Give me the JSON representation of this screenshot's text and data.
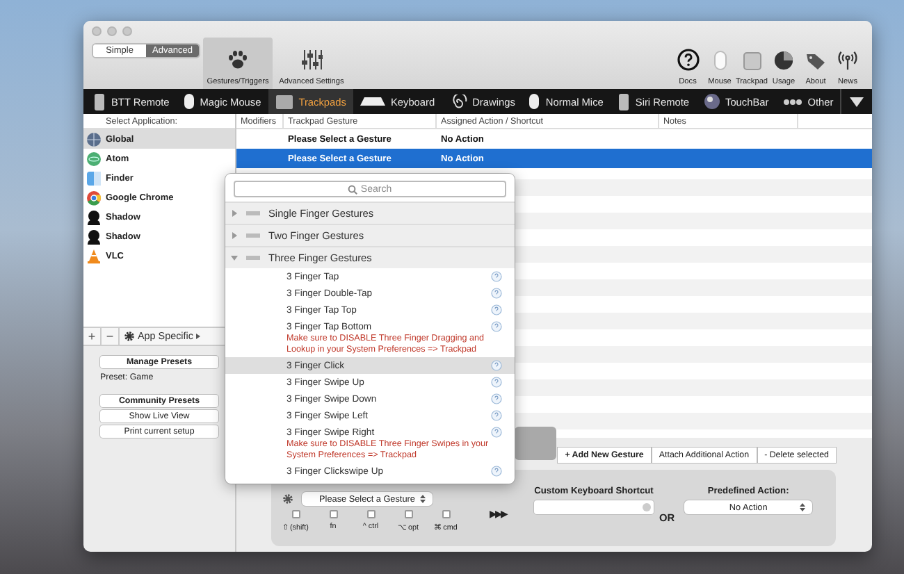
{
  "mode_toggle": [
    {
      "label": "Simple",
      "selected": false
    },
    {
      "label": "Advanced",
      "selected": true
    }
  ],
  "toolbar_tabs": [
    {
      "label": "Gestures/Triggers",
      "selected": true,
      "kind": "paw"
    },
    {
      "label": "Advanced Settings",
      "selected": false,
      "kind": "sliders"
    }
  ],
  "toolbar_icons": [
    {
      "label": "Docs",
      "kind": "help"
    },
    {
      "label": "Mouse",
      "kind": "mouse"
    },
    {
      "label": "Trackpad",
      "kind": "trackpad"
    },
    {
      "label": "Usage",
      "kind": "pie"
    },
    {
      "label": "About",
      "kind": "tag"
    },
    {
      "label": "News",
      "kind": "antenna"
    }
  ],
  "device_tabs": [
    {
      "label": "BTT Remote",
      "selected": false,
      "kind": "remote"
    },
    {
      "label": "Magic Mouse",
      "selected": false,
      "kind": "mouse"
    },
    {
      "label": "Trackpads",
      "selected": true,
      "kind": "trackpad"
    },
    {
      "label": "Keyboard",
      "selected": false,
      "kind": "keyboard"
    },
    {
      "label": "Drawings",
      "selected": false,
      "kind": "spiral"
    },
    {
      "label": "Normal Mice",
      "selected": false,
      "kind": "mouse"
    },
    {
      "label": "Siri Remote",
      "selected": false,
      "kind": "remote"
    },
    {
      "label": "TouchBar",
      "selected": false,
      "kind": "orb"
    },
    {
      "label": "Other",
      "selected": false,
      "kind": "dots"
    }
  ],
  "app_list": {
    "header": "Select Application:",
    "items": [
      {
        "name": "Global",
        "selected": true,
        "kind": "globe"
      },
      {
        "name": "Atom",
        "selected": false,
        "kind": "atom"
      },
      {
        "name": "Finder",
        "selected": false,
        "kind": "finder"
      },
      {
        "name": "Google Chrome",
        "selected": false,
        "kind": "chrome"
      },
      {
        "name": "Shadow",
        "selected": false,
        "kind": "silhouette"
      },
      {
        "name": "Shadow",
        "selected": false,
        "kind": "silhouette"
      },
      {
        "name": "VLC",
        "selected": false,
        "kind": "cone"
      }
    ],
    "add": "+",
    "remove": "−",
    "scope": "App Specific"
  },
  "presets": {
    "manage": "Manage Presets",
    "current": "Preset: Game",
    "community": "Community Presets",
    "live_view": "Show Live View",
    "print": "Print current setup"
  },
  "table": {
    "columns": [
      "Modifiers",
      "Trackpad Gesture",
      "Assigned Action / Shortcut",
      "Notes"
    ],
    "rows": [
      {
        "gesture": "Please Select a Gesture",
        "action": "No Action",
        "selected": false
      },
      {
        "gesture": "Please Select a Gesture",
        "action": "No Action",
        "selected": true
      }
    ]
  },
  "actions": [
    "+ Add New Gesture",
    "Attach Additional Action",
    "- Delete selected"
  ],
  "config": {
    "gesture_select": "Please Select a Gesture",
    "modifiers": [
      {
        "label": "⇧ (shift)",
        "checked": false
      },
      {
        "label": "fn",
        "checked": false
      },
      {
        "label": "^ ctrl",
        "checked": false
      },
      {
        "label": "⌥ opt",
        "checked": false
      },
      {
        "label": "⌘ cmd",
        "checked": false
      }
    ],
    "arrows": "▶▶▶",
    "shortcut_label": "Custom Keyboard Shortcut",
    "or": "OR",
    "predefined_label": "Predefined Action:",
    "predefined_value": "No Action"
  },
  "gesture_menu": {
    "placeholder": "Search",
    "groups": [
      {
        "label": "Single Finger Gestures",
        "expanded": false
      },
      {
        "label": "Two Finger Gestures",
        "expanded": false
      },
      {
        "label": "Three Finger Gestures",
        "expanded": true,
        "children": [
          {
            "label": "3 Finger Tap",
            "selected": false
          },
          {
            "label": "3 Finger Double-Tap",
            "selected": false
          },
          {
            "label": "3 Finger Tap Top",
            "selected": false
          },
          {
            "label": "3 Finger Tap Bottom",
            "selected": false,
            "note": "Make sure to DISABLE Three Finger Dragging and Lookup in your System Preferences => Trackpad"
          },
          {
            "label": "3 Finger Click",
            "selected": true
          },
          {
            "label": "3 Finger Swipe Up",
            "selected": false
          },
          {
            "label": "3 Finger Swipe Down",
            "selected": false
          },
          {
            "label": "3 Finger Swipe Left",
            "selected": false
          },
          {
            "label": "3 Finger Swipe Right",
            "selected": false,
            "note": "Make sure to DISABLE Three Finger Swipes in your System Preferences => Trackpad"
          },
          {
            "label": "3 Finger Clickswipe Up",
            "selected": false
          }
        ]
      }
    ]
  }
}
